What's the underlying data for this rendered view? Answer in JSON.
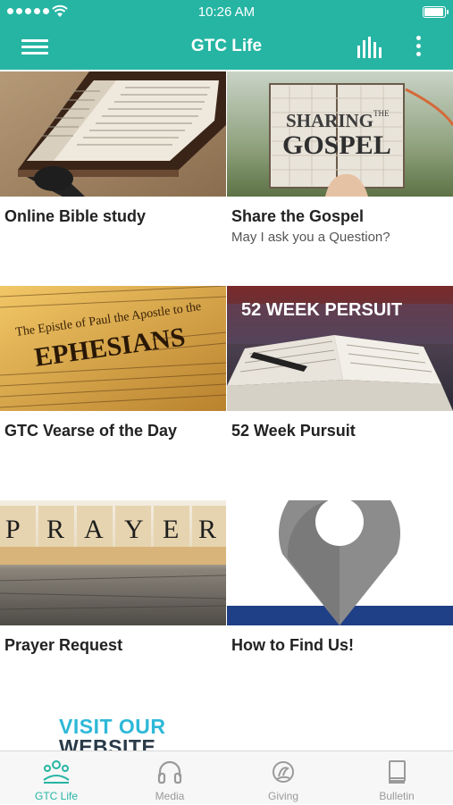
{
  "status_bar": {
    "time": "10:26 AM"
  },
  "app_bar": {
    "title": "GTC Life"
  },
  "tiles": [
    {
      "title": "Online Bible study",
      "subtitle": ""
    },
    {
      "title": "Share the Gospel",
      "subtitle": "May I ask you a Question?"
    },
    {
      "title": "GTC Vearse of the Day",
      "subtitle": ""
    },
    {
      "title": "52 Week Pursuit",
      "subtitle": ""
    },
    {
      "title": "Prayer Request",
      "subtitle": ""
    },
    {
      "title": "How to Find Us!",
      "subtitle": ""
    }
  ],
  "images": {
    "sharing_gospel_line1": "SHARING",
    "sharing_gospel_the": "THE",
    "sharing_gospel_line2": "GOSPEL",
    "ephesians_line1": "The Epistle of Paul the Apostle to the",
    "ephesians_word": "EPHESIANS",
    "pursuit_banner": "52 WEEK PERSUIT",
    "prayer_letters": [
      "P",
      "R",
      "A",
      "Y",
      "E",
      "R"
    ]
  },
  "website_banner": {
    "line1": "VISIT OUR",
    "line2": "WEBSITE"
  },
  "tab_bar": {
    "tabs": [
      {
        "label": "GTC Life",
        "icon": "people-icon",
        "active": true
      },
      {
        "label": "Media",
        "icon": "headphones-icon",
        "active": false
      },
      {
        "label": "Giving",
        "icon": "giving-icon",
        "active": false
      },
      {
        "label": "Bulletin",
        "icon": "book-icon",
        "active": false
      }
    ]
  },
  "colors": {
    "brand": "#26b5a3",
    "inactive_tab": "#9a9a9a"
  }
}
